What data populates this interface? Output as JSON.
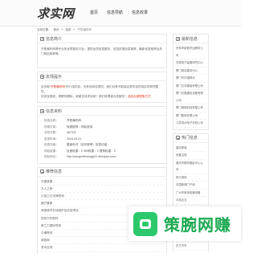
{
  "header": {
    "logo": "求实网",
    "nav": [
      "首页",
      "信息导航",
      "信息收录"
    ]
  },
  "breadcrumb": {
    "items": [
      "当前位置：",
      "首页",
      "»",
      "信息",
      "»",
      "齐鲁瀑布网"
    ],
    "current": "齐鲁瀑布网"
  },
  "intro": {
    "title": "信息简介",
    "text": "齐鲁瀑布网是专业的优质服务平台，提供优质信息服务，包括热搜信息推荐，最新信息推荐及热门网站推荐等。"
  },
  "notice": {
    "title": "友情提示",
    "line1_prefix": "此页面“",
    "line1_highlight": "齐鲁瀑布网",
    "line1_suffix": "”的介绍内容，均来自网友提供，我们对其不能保证其内容的真实性和完整性，",
    "line2_prefix": "如涉及侵权，请联系删除，谢谢支持求实网！我们将竭诚为您服务！",
    "line2_highlight": "此站点被提取方式"
  },
  "info": {
    "title": "信息资料",
    "rows": [
      {
        "k": "信息名称：",
        "v": "齐鲁瀑布网"
      },
      {
        "k": "所属分类：",
        "v": "免费推荐｜网站收录"
      },
      {
        "k": "浏览次数：",
        "v": "3673次"
      },
      {
        "k": "收录时间：",
        "v": "2024-03-21"
      },
      {
        "k": "信息评级：",
        "v": "星级未评（站长推荐）信息评级"
      },
      {
        "k": "网站权重：",
        "v": "百度权重：0 360权重：0 搜狗权重：0"
      },
      {
        "k": "网站地址：",
        "v": "http://uangzhibocuggi22.deloipan.com/"
      }
    ]
  },
  "recommend": {
    "title": "推荐信息",
    "items": [
      "长春铁路",
      "万人之家",
      "沙游之记法律咨询",
      "魔方管家",
      "淘宝城市在线维护及实验项目",
      "西安汽车配件",
      "美兰力国际物流",
      "中通物流",
      "家政网",
      "资讯吉他"
    ]
  },
  "latest": {
    "title": "最新信息",
    "items": [
      "东莞市新城货运服务公司",
      "中国电子装备研究中心",
      "厦门网站建设中心",
      "厦门市中国移动",
      "厦门五丰服装有限公司",
      "厦门光路通信设备有限公司",
      "厦门网络科技有限公司",
      "厦门数码有限公司",
      "江苏常州电子实验公司"
    ]
  },
  "hot": {
    "title": "热门信息",
    "items": [
      "重庆家装",
      "优客吉他",
      "重庆市数码摄影中心公司",
      "珠江网络",
      "中国新闻门户网",
      "广州市家用电器设备",
      "众游企业",
      "快速家政",
      "上海金融信息网",
      "上海网站优化公司",
      "上海汽车维修公司",
      "上海搬家公司",
      "东方汽车"
    ]
  },
  "ad": {
    "text": "策腕网赚",
    "icon": "wechat-icon",
    "color": "#1aa84f"
  }
}
